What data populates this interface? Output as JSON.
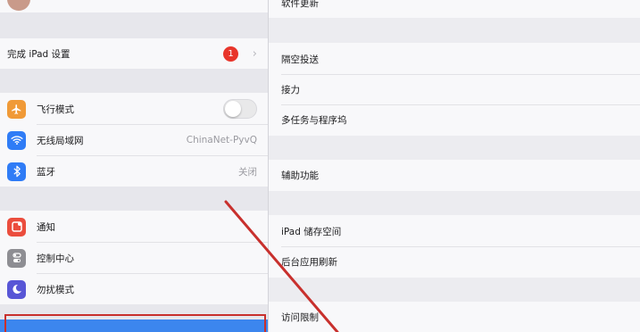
{
  "sidebar": {
    "finish_setup": {
      "label": "完成 iPad 设置",
      "badge": "1"
    },
    "connectivity": [
      {
        "label": "飞行模式",
        "icon": "airplane-icon",
        "color": "#f09a37"
      },
      {
        "label": "无线局域网",
        "value": "ChinaNet-PyvQ",
        "icon": "wifi-icon",
        "color": "#2f7cf6"
      },
      {
        "label": "蓝牙",
        "value": "关闭",
        "icon": "bluetooth-icon",
        "color": "#2f7cf6"
      }
    ],
    "general": [
      {
        "label": "通知",
        "icon": "notifications-icon",
        "color": "#eb4d3d"
      },
      {
        "label": "控制中心",
        "icon": "control-center-icon",
        "color": "#8e8e93"
      },
      {
        "label": "勿扰模式",
        "icon": "moon-icon",
        "color": "#5856d6"
      }
    ]
  },
  "detail": {
    "software_update": "软件更新",
    "group1": [
      "隔空投送",
      "接力",
      "多任务与程序坞"
    ],
    "accessibility": "辅助功能",
    "group3": [
      "iPad 储存空间",
      "后台应用刷新"
    ],
    "restrictions": "访问限制"
  },
  "annotation": {
    "highlight_color": "#c8302d"
  }
}
